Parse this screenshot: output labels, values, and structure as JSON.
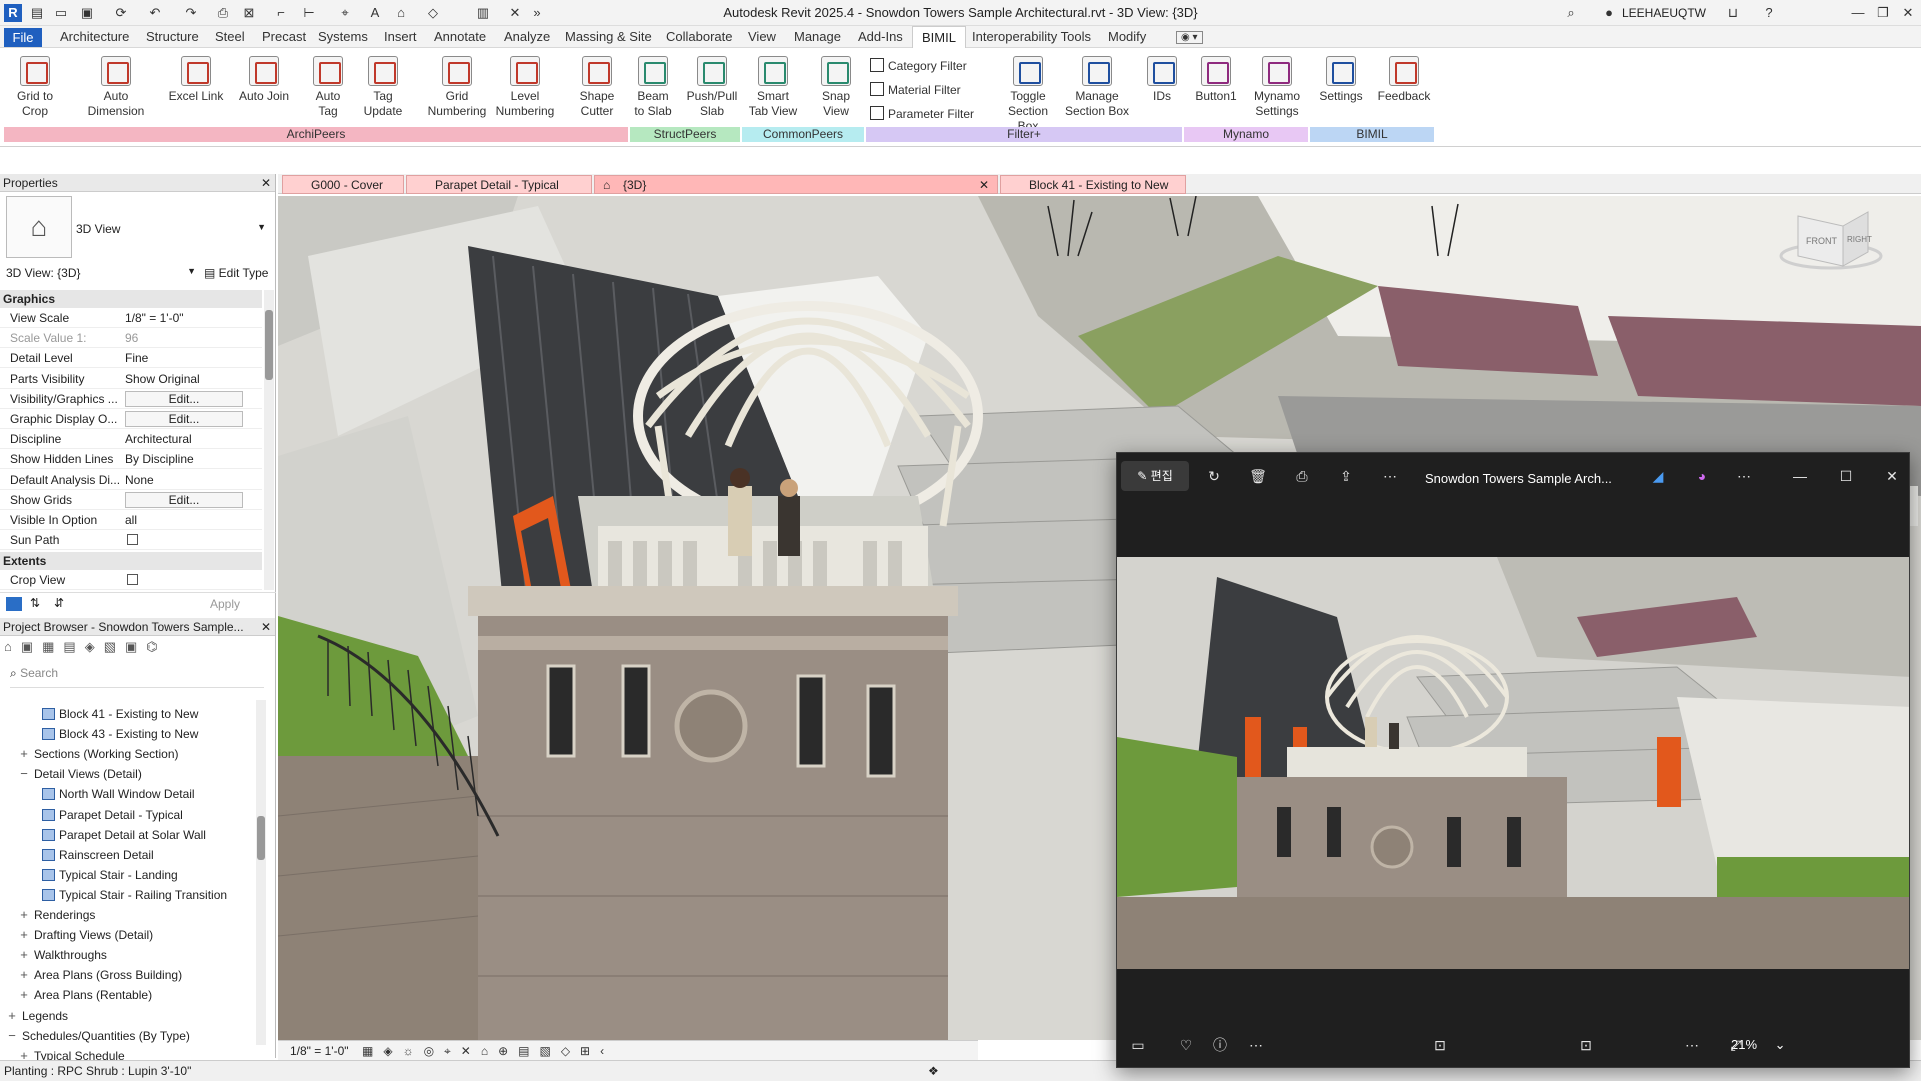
{
  "titlebar": {
    "title": "Autodesk Revit 2025.4 - Snowdon Towers Sample Architectural.rvt - 3D View: {3D}",
    "user": "LEEHAEUQTW"
  },
  "ribbon_tabs": [
    "File",
    "Architecture",
    "Structure",
    "Steel",
    "Precast",
    "Systems",
    "Insert",
    "Annotate",
    "Analyze",
    "Massing & Site",
    "Collaborate",
    "View",
    "Manage",
    "Add-Ins",
    "BIMIL",
    "Interoperability Tools",
    "Modify"
  ],
  "ribbon_buttons": [
    {
      "l1": "Grid to",
      "l2": "Crop"
    },
    {
      "l1": "Auto",
      "l2": "Dimension"
    },
    {
      "l1": "Excel Link",
      "l2": ""
    },
    {
      "l1": "Auto Join",
      "l2": ""
    },
    {
      "l1": "Auto",
      "l2": "Tag"
    },
    {
      "l1": "Tag",
      "l2": "Update"
    },
    {
      "l1": "Grid",
      "l2": "Numbering"
    },
    {
      "l1": "Level",
      "l2": "Numbering"
    },
    {
      "l1": "Shape",
      "l2": "Cutter"
    },
    {
      "l1": "Beam",
      "l2": "to Slab"
    },
    {
      "l1": "Push/Pull",
      "l2": "Slab"
    },
    {
      "l1": "Smart",
      "l2": "Tab View"
    },
    {
      "l1": "Snap",
      "l2": "View"
    },
    {
      "l1": "Toggle",
      "l2": "Section Box"
    },
    {
      "l1": "Manage",
      "l2": "Section Box"
    },
    {
      "l1": "IDs",
      "l2": ""
    },
    {
      "l1": "Button1",
      "l2": ""
    },
    {
      "l1": "Mynamo",
      "l2": "Settings"
    },
    {
      "l1": "Settings",
      "l2": ""
    },
    {
      "l1": "Feedback",
      "l2": ""
    }
  ],
  "filters": [
    "Category Filter",
    "Material Filter",
    "Parameter Filter"
  ],
  "panels": [
    {
      "name": "ArchiPeers",
      "color": "#f4b6c2"
    },
    {
      "name": "StructPeers",
      "color": "#b6e8c0"
    },
    {
      "name": "CommonPeers",
      "color": "#b6ecf0"
    },
    {
      "name": "Filter+",
      "color": "#d6c8f4"
    },
    {
      "name": "Mynamo",
      "color": "#e8c8f4"
    },
    {
      "name": "BIMIL",
      "color": "#bcd6f4"
    }
  ],
  "properties": {
    "title": "Properties",
    "type_name": "3D View",
    "selector": "3D View: {3D}",
    "edit_type": "Edit Type",
    "section_graphics": "Graphics",
    "section_extents": "Extents",
    "apply": "Apply",
    "rows": [
      {
        "k": "View Scale",
        "v": "1/8\" = 1'-0\""
      },
      {
        "k": "Scale Value    1:",
        "v": "96"
      },
      {
        "k": "Detail Level",
        "v": "Fine"
      },
      {
        "k": "Parts Visibility",
        "v": "Show Original"
      },
      {
        "k": "Visibility/Graphics ...",
        "v": "Edit..."
      },
      {
        "k": "Graphic Display O...",
        "v": "Edit..."
      },
      {
        "k": "Discipline",
        "v": "Architectural"
      },
      {
        "k": "Show Hidden Lines",
        "v": "By Discipline"
      },
      {
        "k": "Default Analysis Di...",
        "v": "None"
      },
      {
        "k": "Show Grids",
        "v": "Edit..."
      },
      {
        "k": "Visible In Option",
        "v": "all"
      },
      {
        "k": "Sun Path",
        "v": ""
      }
    ],
    "crop_view": "Crop View"
  },
  "browser": {
    "title": "Project Browser - Snowdon Towers Sample...",
    "search": "Search",
    "items": [
      {
        "t": "Block 41 - Existing to New",
        "lvl": 3,
        "view": true
      },
      {
        "t": "Block 43 - Existing to New",
        "lvl": 3,
        "view": true
      },
      {
        "t": "Sections (Working Section)",
        "lvl": 1,
        "ex": "+"
      },
      {
        "t": "Detail Views (Detail)",
        "lvl": 1,
        "ex": "−"
      },
      {
        "t": "North Wall Window Detail",
        "lvl": 3,
        "view": true
      },
      {
        "t": "Parapet Detail - Typical",
        "lvl": 3,
        "view": true
      },
      {
        "t": "Parapet Detail at Solar Wall",
        "lvl": 3,
        "view": true
      },
      {
        "t": "Rainscreen Detail",
        "lvl": 3,
        "view": true
      },
      {
        "t": "Typical Stair - Landing",
        "lvl": 3,
        "view": true
      },
      {
        "t": "Typical Stair - Railing Transition",
        "lvl": 3,
        "view": true
      },
      {
        "t": "Renderings",
        "lvl": 1,
        "ex": "+"
      },
      {
        "t": "Drafting Views (Detail)",
        "lvl": 1,
        "ex": "+"
      },
      {
        "t": "Walkthroughs",
        "lvl": 1,
        "ex": "+"
      },
      {
        "t": "Area Plans (Gross Building)",
        "lvl": 1,
        "ex": "+"
      },
      {
        "t": "Area Plans (Rentable)",
        "lvl": 1,
        "ex": "+"
      },
      {
        "t": "Legends",
        "lvl": 0,
        "ex": "+"
      },
      {
        "t": "Schedules/Quantities (By Type)",
        "lvl": 0,
        "ex": "−"
      },
      {
        "t": "Typical Schedule",
        "lvl": 1,
        "ex": "+"
      }
    ]
  },
  "view_tabs": [
    "G000 - Cover",
    "Parapet Detail - Typical",
    "{3D}",
    "Block 41 - Existing to New"
  ],
  "view_scale": "1/8\" = 1'-0\"",
  "status": "Planting : RPC Shrub : Lupin 3'-10\"",
  "viewcube": {
    "front": "FRONT",
    "right": "RIGHT"
  },
  "photo_viewer": {
    "title": "Snowdon Towers Sample Arch...",
    "edit": "편집",
    "zoom": "21%"
  }
}
